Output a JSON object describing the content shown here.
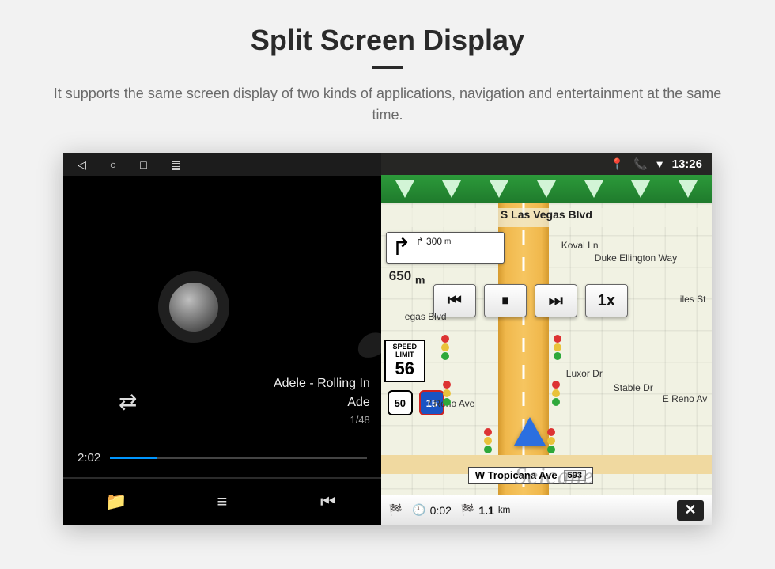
{
  "header": {
    "title": "Split Screen Display",
    "subtitle": "It supports the same screen display of two kinds of applications, navigation and entertainment at the same time."
  },
  "statusbar": {
    "back": "◁",
    "home": "○",
    "recent": "□",
    "gallery": "▤"
  },
  "nav_status": {
    "pin": "📍",
    "phone": "📞",
    "wifi": "▾",
    "time": "13:26"
  },
  "music": {
    "track_title": "Adele - Rolling In",
    "artist": "Ade",
    "track_count": "1/48",
    "elapsed": "2:02",
    "bottom": {
      "files": "📁",
      "list": "≡",
      "prev": "⏮"
    }
  },
  "map": {
    "top_street": "S Las Vegas Blvd",
    "turn": {
      "next_dist": "300",
      "next_unit": "m",
      "main_dist": "650",
      "main_unit": "m"
    },
    "controls": {
      "prev": "⏮",
      "pause": "⏸",
      "next": "⏭",
      "speed": "1x"
    },
    "speed_limit": {
      "label": "SPEED LIMIT",
      "value": "56"
    },
    "shields": {
      "route1": "50",
      "route2": "15"
    },
    "bottom_street": "W Tropicana Ave",
    "bottom_street_no": "593",
    "pois": {
      "koval": "Koval Ln",
      "duke": "Duke Ellington Way",
      "vegas_blvd": "egas Blvd",
      "luxor": "Luxor Dr",
      "stable": "Stable Dr",
      "reno_e": "E Reno Av",
      "reno_w": "/ Reno Ave",
      "miles": "iles St"
    },
    "bottombar": {
      "progress_time": "0:02",
      "dist_to_flag": "1.1",
      "dist_unit": "km",
      "close": "✕"
    }
  },
  "watermark": "Seicane"
}
